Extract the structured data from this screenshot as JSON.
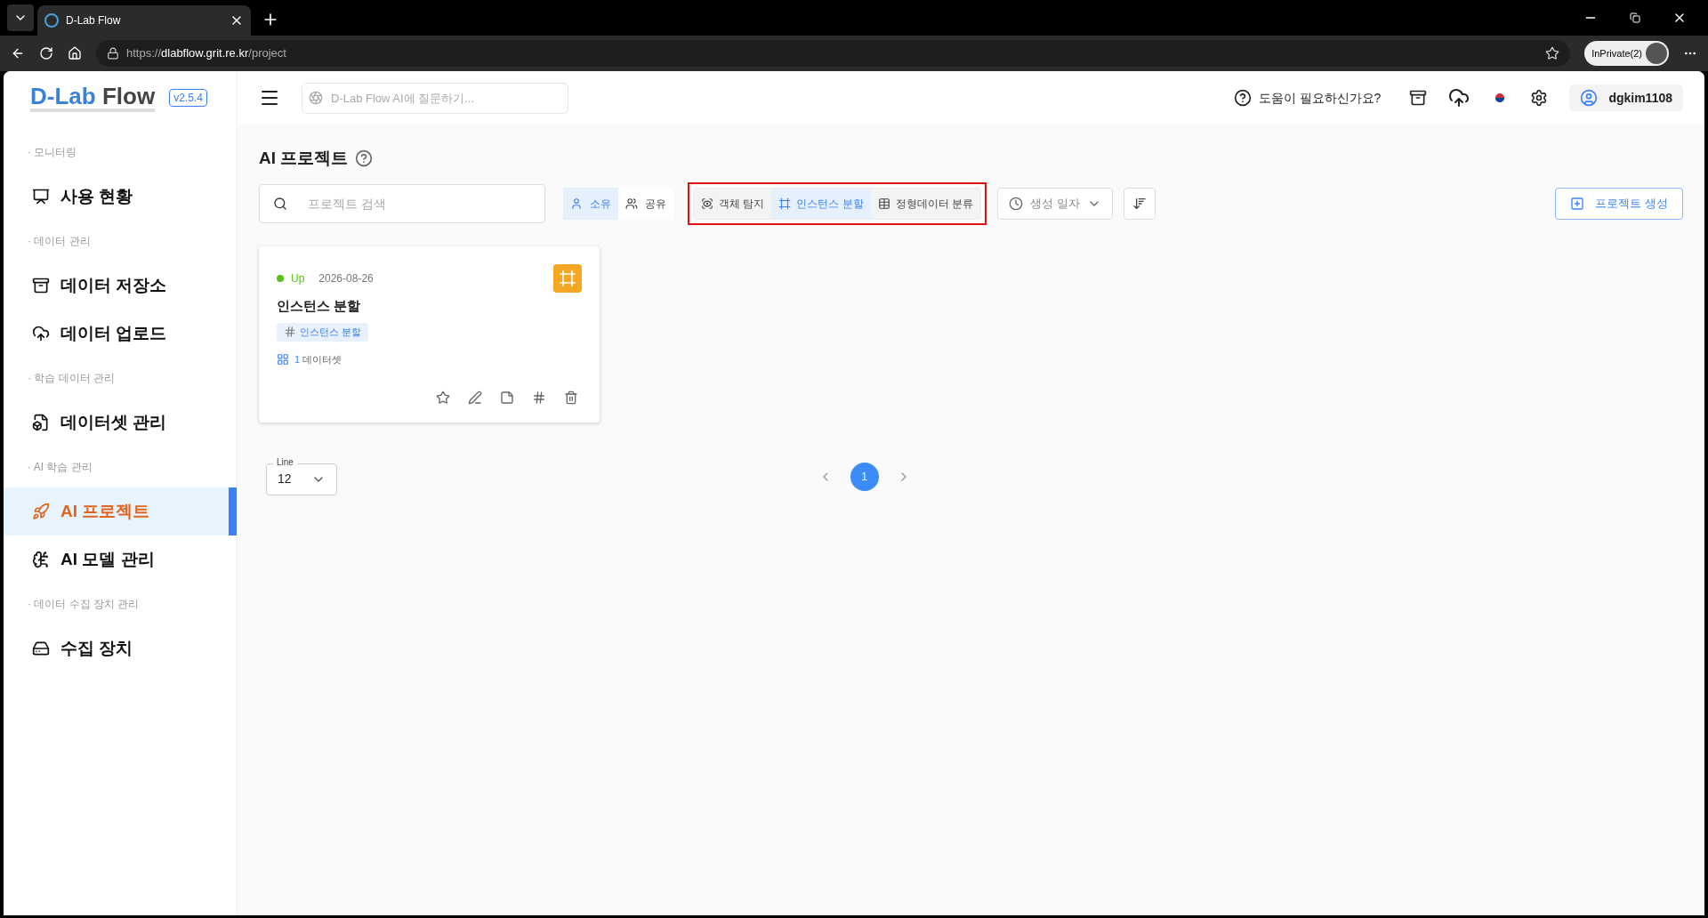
{
  "browser": {
    "tabs": [
      {
        "title": "D-Lab Flow",
        "selected": true
      }
    ],
    "url": {
      "scheme": "https://",
      "host": "dlabflow.grit.re.kr",
      "path": "/project"
    },
    "profile": "InPrivate(2)"
  },
  "header": {
    "logo_first": "D-Lab",
    "logo_second": "Flow",
    "version": "v2.5.4",
    "ai_placeholder": "D-Lab Flow AI에 질문하기...",
    "help": "도움이 필요하신가요?",
    "user": "dgkim1108"
  },
  "sidebar": {
    "sections": [
      {
        "label": "· 모니터링",
        "items": [
          {
            "label": "사용 현황",
            "kind": "usage",
            "selected": false
          }
        ]
      },
      {
        "label": "· 데이터 관리",
        "items": [
          {
            "label": "데이터 저장소",
            "kind": "storage",
            "selected": false
          },
          {
            "label": "데이터 업로드",
            "kind": "upload",
            "selected": false
          }
        ]
      },
      {
        "label": "· 학습 데이터 관리",
        "items": [
          {
            "label": "데이터셋 관리",
            "kind": "dataset",
            "selected": false
          }
        ]
      },
      {
        "label": "· AI 학습 관리",
        "items": [
          {
            "label": "AI 프로젝트",
            "kind": "project",
            "selected": true
          },
          {
            "label": "AI 모델 관리",
            "kind": "model",
            "selected": false
          }
        ]
      },
      {
        "label": "· 데이터 수집 장치 관리",
        "items": [
          {
            "label": "수집 장치",
            "kind": "device",
            "selected": false
          }
        ]
      }
    ]
  },
  "page": {
    "title": "AI 프로젝트",
    "search_placeholder": "프로젝트 검색",
    "ownership": [
      {
        "label": "소유",
        "kind": "own",
        "selected": true
      },
      {
        "label": "공유",
        "kind": "shared",
        "selected": false
      }
    ],
    "types": [
      {
        "label": "객체 탐지",
        "kind": "detection",
        "selected": false
      },
      {
        "label": "인스턴스 분할",
        "kind": "segmentation",
        "selected": true
      },
      {
        "label": "정형데이터 분류",
        "kind": "tabular",
        "selected": false
      }
    ],
    "sort": "생성 일자",
    "create": "프로젝트 생성"
  },
  "cards": [
    {
      "status": "Up",
      "date": "2026-08-26",
      "title": "인스턴스 분할",
      "kind": "segmentation",
      "tag": "인스턴스 분할",
      "dataset_count": "1",
      "dataset_label": "데이터셋"
    }
  ],
  "pagination": {
    "line_label": "Line",
    "line_value": "12",
    "pages": [
      {
        "label": "1",
        "selected": true
      }
    ]
  }
}
